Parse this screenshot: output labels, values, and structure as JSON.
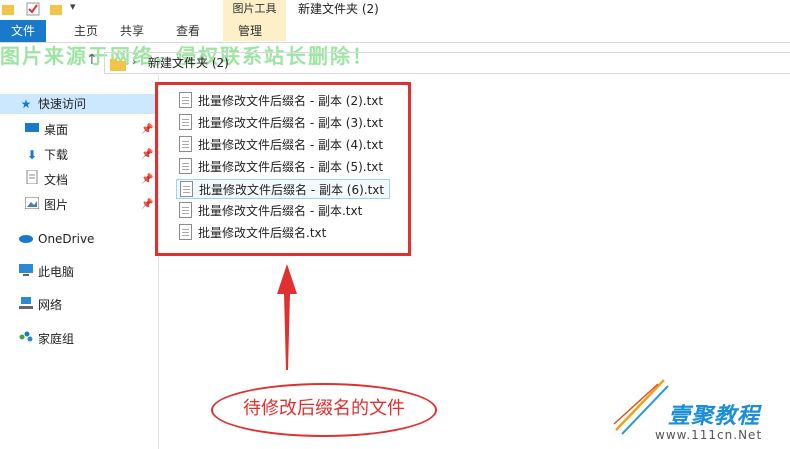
{
  "titlebar": {
    "context_tab": "图片工具",
    "window_title": "新建文件夹 (2)"
  },
  "ribbon": {
    "tabs": [
      "文件",
      "主页",
      "共享",
      "查看",
      "管理"
    ]
  },
  "watermark": "图片来源于网络，侵权联系站长删除！",
  "address": {
    "path": "新建文件夹 (2)"
  },
  "sidebar": {
    "items": [
      {
        "label": "快速访问",
        "icon": "star-icon",
        "pinned": false
      },
      {
        "label": "桌面",
        "icon": "desktop-icon",
        "pinned": true
      },
      {
        "label": "下载",
        "icon": "download-icon",
        "pinned": true
      },
      {
        "label": "文档",
        "icon": "document-icon",
        "pinned": true
      },
      {
        "label": "图片",
        "icon": "picture-icon",
        "pinned": true
      },
      {
        "label": "OneDrive",
        "icon": "cloud-icon",
        "pinned": false
      },
      {
        "label": "此电脑",
        "icon": "computer-icon",
        "pinned": false
      },
      {
        "label": "网络",
        "icon": "network-icon",
        "pinned": false
      },
      {
        "label": "家庭组",
        "icon": "homegroup-icon",
        "pinned": false
      }
    ]
  },
  "files": [
    "批量修改文件后缀名 - 副本 (2).txt",
    "批量修改文件后缀名 - 副本 (3).txt",
    "批量修改文件后缀名 - 副本 (4).txt",
    "批量修改文件后缀名 - 副本 (5).txt",
    "批量修改文件后缀名 - 副本 (6).txt",
    "批量修改文件后缀名 - 副本.txt",
    "批量修改文件后缀名.txt"
  ],
  "annotation": {
    "label": "待修改后缀名的文件",
    "color": "#e03030"
  },
  "logo": {
    "name": "壹聚教程",
    "url": "www.111cn.Net"
  }
}
